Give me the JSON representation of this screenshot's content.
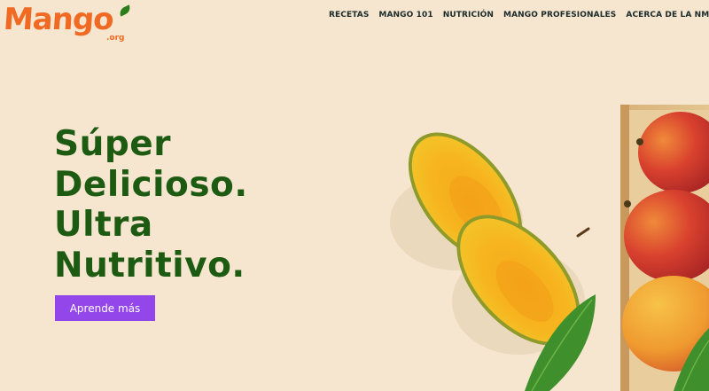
{
  "brand": {
    "name": "Mango",
    "suffix": ".org",
    "color": "#f06a24",
    "leaf_color": "#2e7d1b"
  },
  "nav": {
    "items": [
      {
        "label": "RECETAS"
      },
      {
        "label": "MANGO 101"
      },
      {
        "label": "NUTRICIÓN"
      },
      {
        "label": "MANGO PROFESIONALES"
      },
      {
        "label": "ACERCA DE LA NMB"
      }
    ],
    "search_icon": "search-icon"
  },
  "hero": {
    "lines": [
      "Súper",
      "Delicioso.",
      "Ultra",
      "Nutritivo."
    ],
    "headline_color": "#1d5a12",
    "cta_label": "Aprende más",
    "cta_color": "#9346ea"
  },
  "colors": {
    "background": "#f6e6cf"
  }
}
